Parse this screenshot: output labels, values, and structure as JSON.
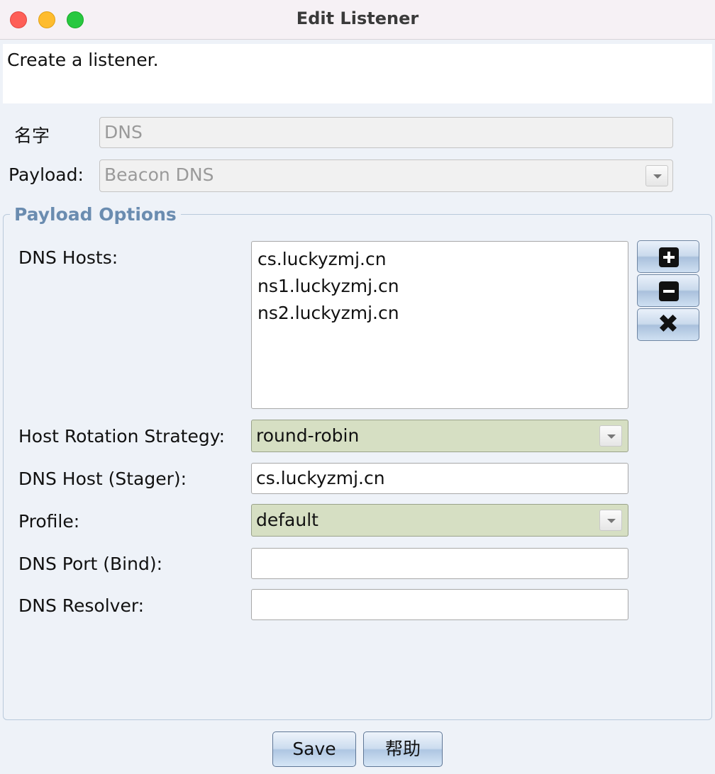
{
  "window": {
    "title": "Edit Listener"
  },
  "description": "Create a listener.",
  "fields": {
    "name_label": "名字",
    "name_value": "DNS",
    "payload_label": "Payload:",
    "payload_value": "Beacon DNS"
  },
  "payload_options": {
    "group_title": "Payload Options",
    "dns_hosts_label": "DNS Hosts:",
    "dns_hosts": [
      "cs.luckyzmj.cn",
      "ns1.luckyzmj.cn",
      "ns2.luckyzmj.cn"
    ],
    "list_buttons": {
      "add_icon": "plus-icon",
      "remove_icon": "minus-icon",
      "clear_icon": "x-icon"
    },
    "rotation_label": "Host Rotation Strategy:",
    "rotation_value": "round-robin",
    "stager_label": "DNS Host (Stager):",
    "stager_value": "cs.luckyzmj.cn",
    "profile_label": "Profile:",
    "profile_value": "default",
    "port_label": "DNS Port (Bind):",
    "port_value": "",
    "resolver_label": "DNS Resolver:",
    "resolver_value": ""
  },
  "buttons": {
    "save": "Save",
    "help": "帮助"
  },
  "colors": {
    "combo_bg": "#d6dfc3",
    "group_title": "#6a8cb0",
    "button_blue": "#aec6e2"
  }
}
